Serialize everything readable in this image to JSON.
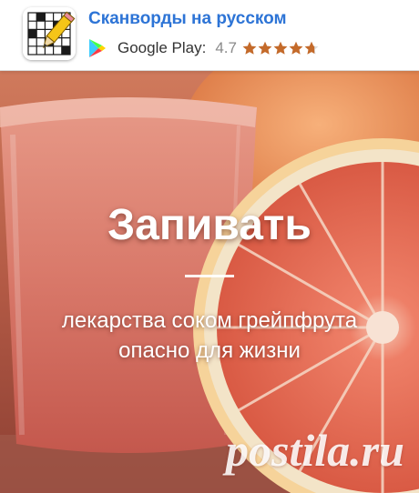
{
  "ad": {
    "app_name": "Сканворды на русском",
    "store_name": "Google Play:",
    "rating": "4.7",
    "stars": {
      "rating_value": 4.7,
      "max": 5
    },
    "colors": {
      "title": "#2d74d6",
      "star": "#c46a2a"
    },
    "icons": {
      "app": "crossword-pencil-icon",
      "store": "google-play-icon",
      "star": "star-icon"
    }
  },
  "post": {
    "headline": "Запивать",
    "subtitle": "лекарства соком грейпфрута опасно для жизни",
    "watermark": "postila.ru"
  }
}
